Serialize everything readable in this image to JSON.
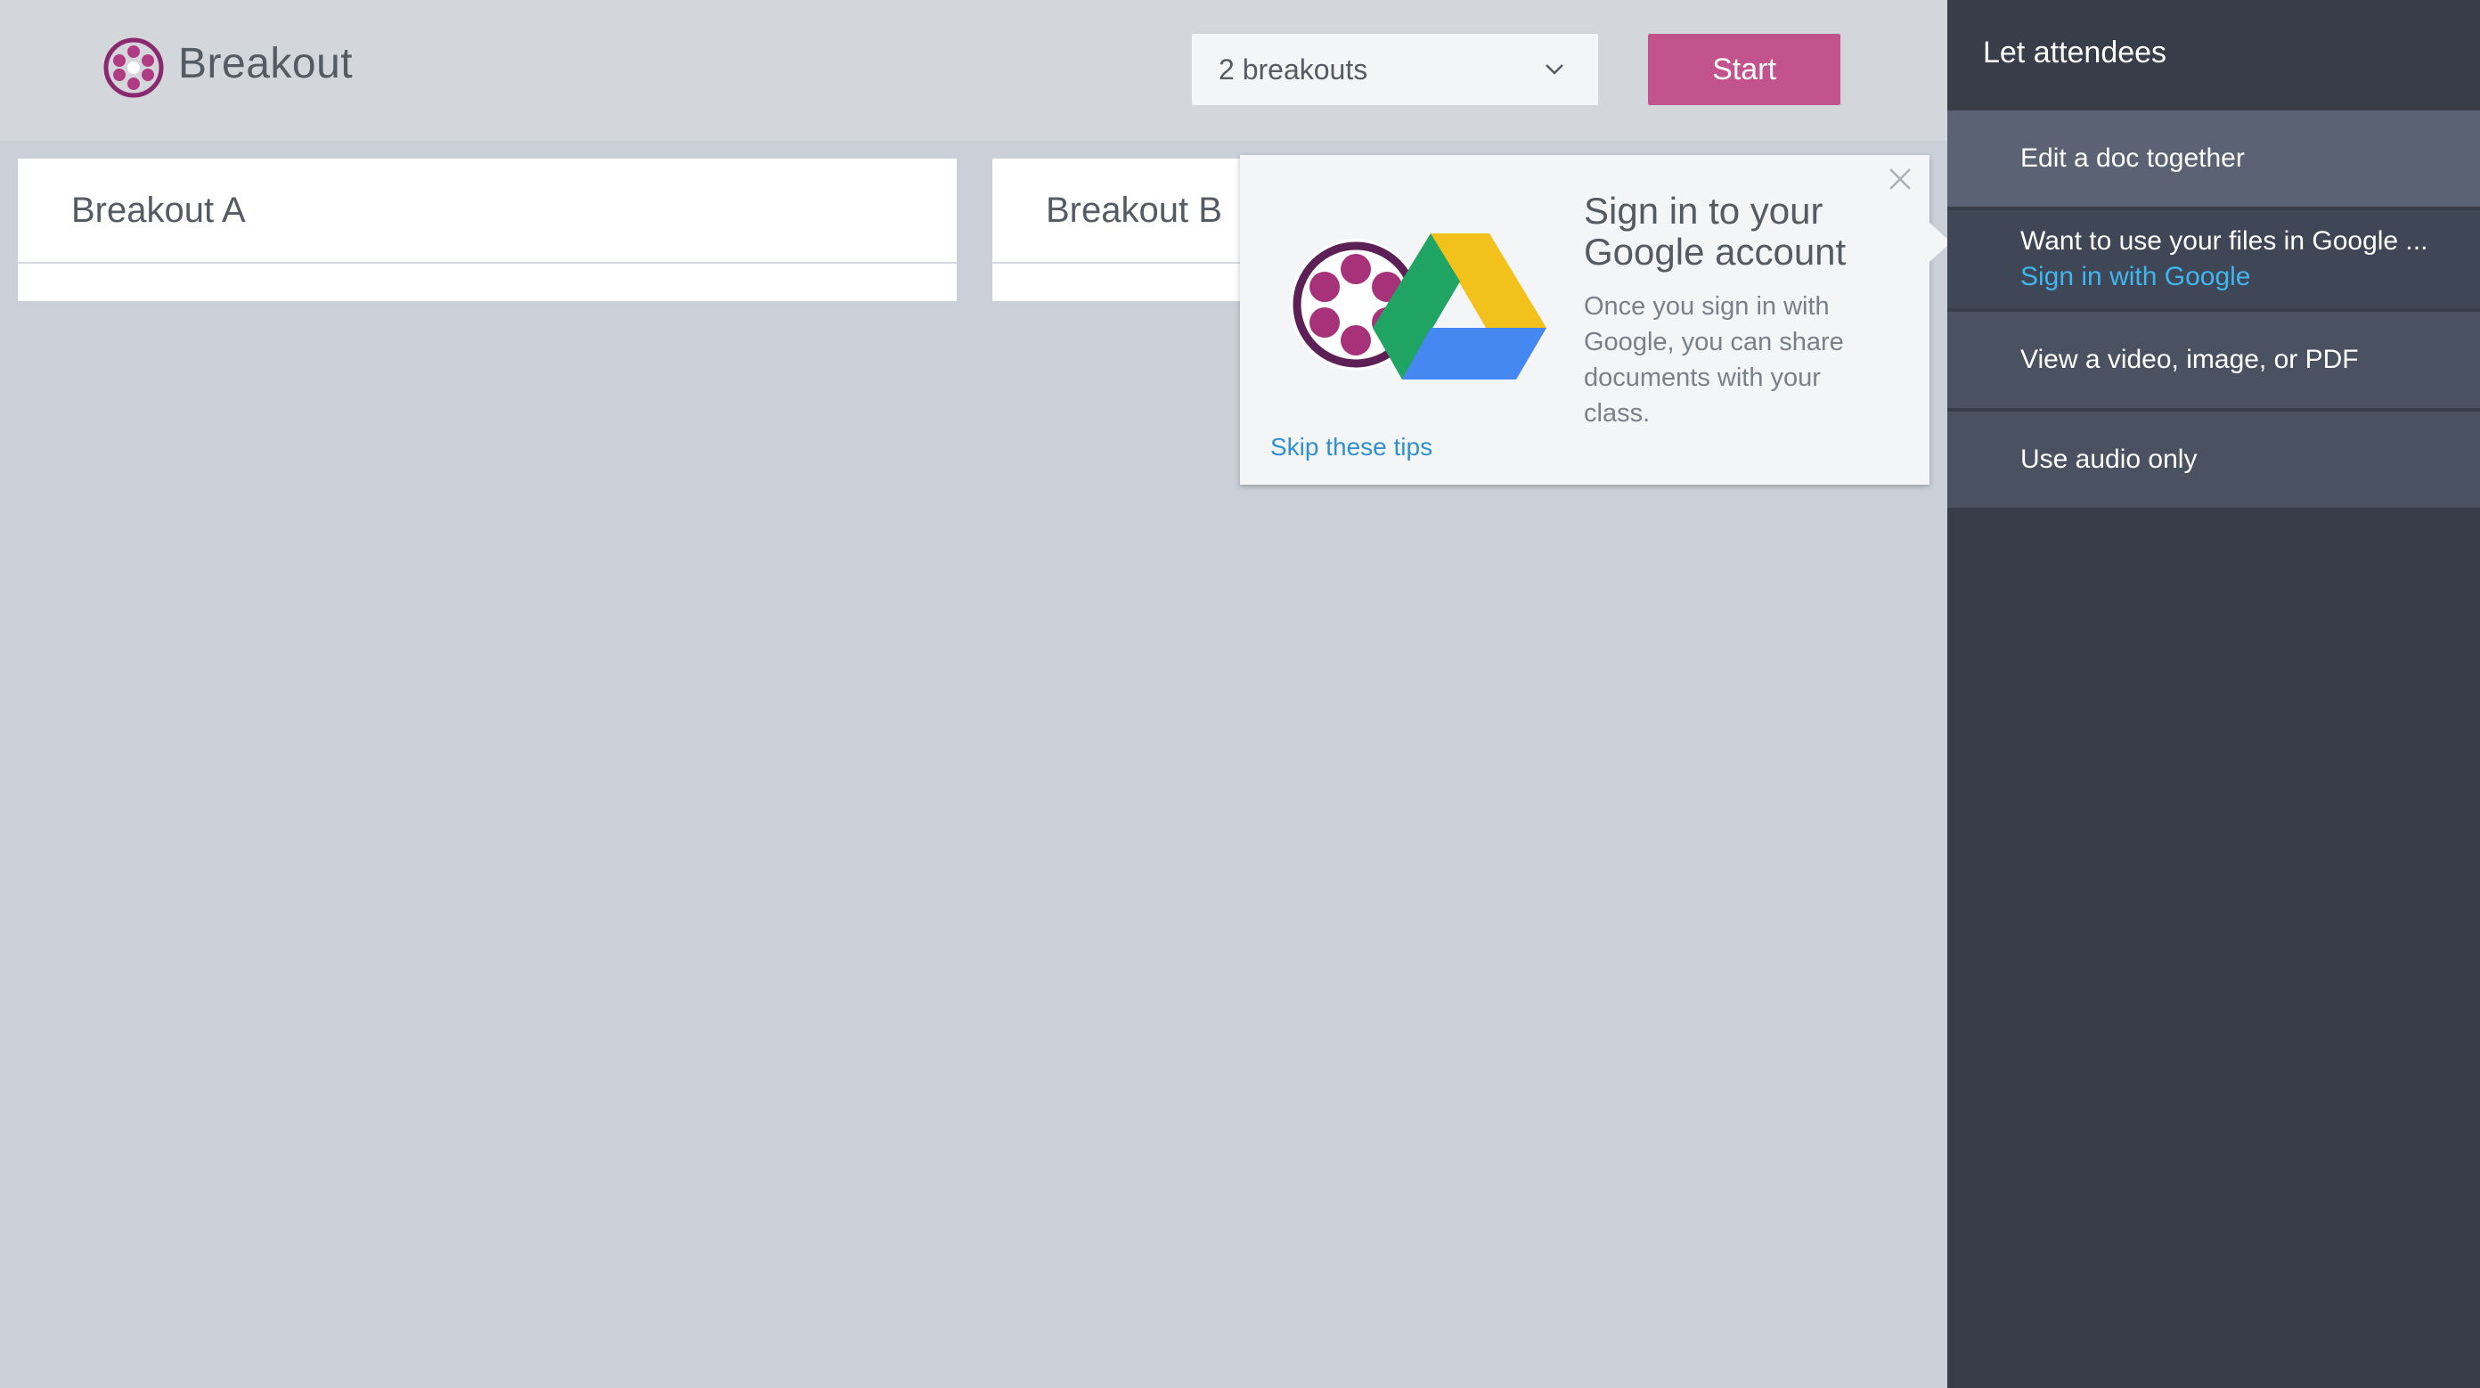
{
  "header": {
    "app_title": "Breakout",
    "select_value": "2 breakouts",
    "start_label": "Start"
  },
  "breakouts": [
    {
      "name": "Breakout A"
    },
    {
      "name": "Breakout B"
    }
  ],
  "tip": {
    "title": "Sign in to your Google account",
    "body": "Once you sign in with Google, you can share documents with your class.",
    "skip_label": "Skip these tips"
  },
  "sidebar": {
    "title": "Let attendees",
    "items": [
      {
        "label": "Edit a doc together"
      },
      {
        "label": "Want to use your files in Google ...",
        "link": "Sign in with Google"
      },
      {
        "label": "View a video, image, or PDF"
      },
      {
        "label": "Use audio only"
      }
    ]
  },
  "colors": {
    "accent": "#c3538d",
    "link": "#2f8fd1",
    "sidebar_bg": "#373e4a"
  }
}
